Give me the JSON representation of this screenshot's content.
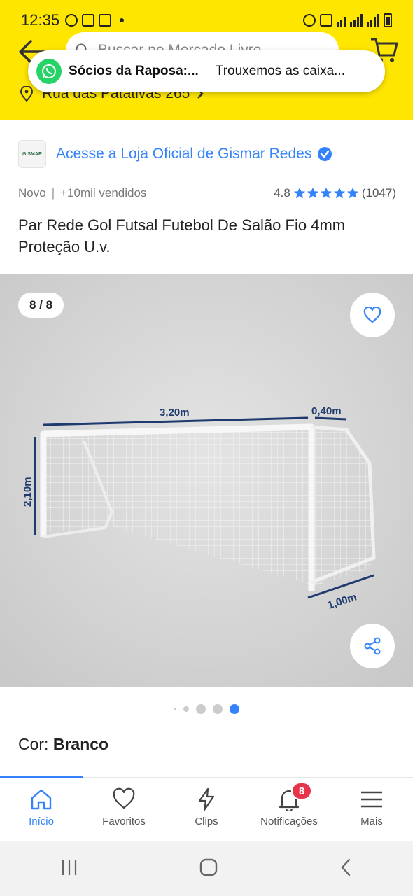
{
  "status_bar": {
    "time": "12:35"
  },
  "search": {
    "placeholder": "Buscar no Mercado Livre"
  },
  "address": {
    "text": "Rua das Patativas 265"
  },
  "notification": {
    "title": "Sócios da Raposa:...",
    "message": "Trouxemos as caixa..."
  },
  "store": {
    "link_text": "Acesse a Loja Oficial de Gismar Redes",
    "logo_text": "GISMAR"
  },
  "product": {
    "condition": "Novo",
    "sold": "+10mil vendidos",
    "rating": "4.8",
    "reviews": "(1047)",
    "stars": 5,
    "title": "Par Rede Gol Futsal Futebol De Salão Fio 4mm Proteção U.v."
  },
  "gallery": {
    "counter": "8 / 8",
    "dim_width": "3,20m",
    "dim_depth_top": "0,40m",
    "dim_height": "2,10m",
    "dim_depth_bottom": "1,00m",
    "current_index": 5,
    "total_dots": 5
  },
  "variant": {
    "label": "Cor:",
    "value": "Branco"
  },
  "tabs": [
    {
      "label": "Início",
      "icon": "home-icon",
      "active": true
    },
    {
      "label": "Favoritos",
      "icon": "heart-icon"
    },
    {
      "label": "Clips",
      "icon": "lightning-icon"
    },
    {
      "label": "Notificações",
      "icon": "bell-icon",
      "badge": "8"
    },
    {
      "label": "Mais",
      "icon": "menu-icon"
    }
  ],
  "colors": {
    "header_yellow": "#ffe600",
    "accent_blue": "#3483fa",
    "badge_red": "#e8344b",
    "whatsapp_green": "#25d366"
  }
}
